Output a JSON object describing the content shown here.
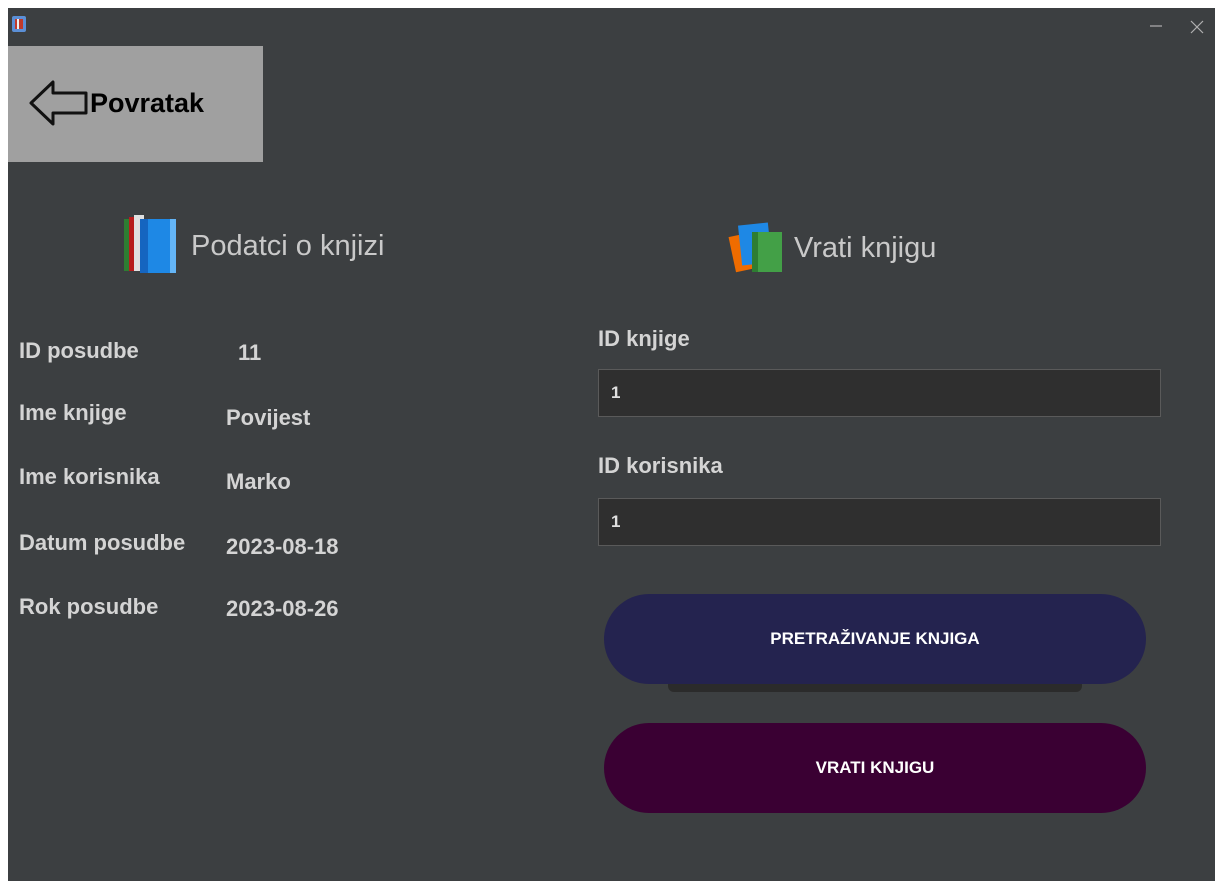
{
  "window": {
    "title": "",
    "controls": {
      "minimize_icon": "minimize-icon",
      "close_icon": "close-icon"
    }
  },
  "back_button": {
    "label": "Povratak",
    "icon": "arrow-left-icon"
  },
  "left_panel": {
    "heading": "Podatci o knjizi",
    "heading_icon": "books-icon",
    "rows": [
      {
        "label": "ID posudbe",
        "value": "11"
      },
      {
        "label": "Ime knjige",
        "value": "Povijest"
      },
      {
        "label": "Ime korisnika",
        "value": "Marko"
      },
      {
        "label": "Datum posudbe",
        "value": "2023-08-18"
      },
      {
        "label": "Rok posudbe",
        "value": "2023-08-26"
      }
    ]
  },
  "right_panel": {
    "heading": "Vrati knjigu",
    "heading_icon": "book-return-icon",
    "book_id": {
      "label": "ID knjige",
      "value": "1"
    },
    "user_id": {
      "label": "ID korisnika",
      "value": "1"
    },
    "search_button": {
      "label": "PRETRAŽIVANJE KNJIGA"
    },
    "return_button": {
      "label": "VRATI KNJIGU"
    }
  },
  "colors": {
    "window_bg": "#3c3f41",
    "back_button_bg": "#a0a0a0",
    "search_button_bg": "#24234f",
    "return_button_bg": "#3a0033",
    "text": "#d4d4d4"
  }
}
